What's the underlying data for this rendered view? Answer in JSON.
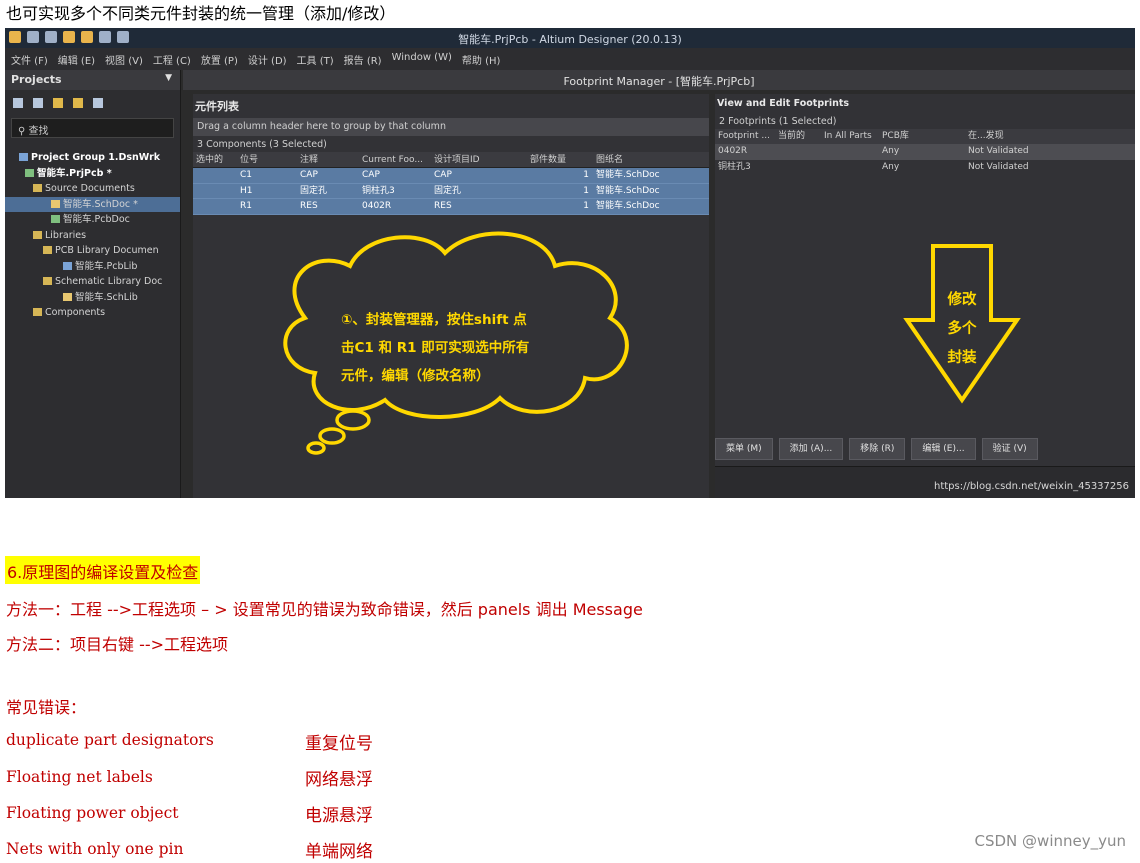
{
  "intro_text": "也可实现多个不同类元件封装的统一管理（添加/修改）",
  "app": {
    "title": "智能车.PrjPcb - Altium Designer (20.0.13)",
    "menu": [
      "文件 (F)",
      "编辑 (E)",
      "视图 (V)",
      "工程 (C)",
      "放置 (P)",
      "设计 (D)",
      "工具 (T)",
      "报告 (R)",
      "Window (W)",
      "帮助 (H)"
    ]
  },
  "projects_panel": {
    "header": "Projects",
    "search_placeholder": "查找",
    "tree": [
      "Project Group 1.DsnWrk",
      "智能车.PrjPcb *",
      "Source Documents",
      "智能车.SchDoc *",
      "智能车.PcbDoc",
      "Libraries",
      "PCB Library Documen",
      "智能车.PcbLib",
      "Schematic Library Doc",
      "智能车.SchLib",
      "Components"
    ]
  },
  "footprint_manager": {
    "title": "Footprint Manager - [智能车.PrjPcb]",
    "component_list": {
      "title": "元件列表",
      "group_hint": "Drag a column header here to group by that column",
      "count": "3 Components (3 Selected)",
      "columns": [
        "选中的",
        "位号",
        "注释",
        "Current Foo...",
        "设计项目ID",
        "部件数量",
        "图纸名"
      ],
      "rows": [
        [
          "",
          "C1",
          "CAP",
          "CAP",
          "CAP",
          "1",
          "智能车.SchDoc"
        ],
        [
          "",
          "H1",
          "固定孔",
          "铜柱孔3",
          "固定孔",
          "1",
          "智能车.SchDoc"
        ],
        [
          "",
          "R1",
          "RES",
          "0402R",
          "RES",
          "1",
          "智能车.SchDoc"
        ]
      ]
    },
    "footprints": {
      "title": "View and Edit Footprints",
      "count": "2 Footprints (1 Selected)",
      "columns": [
        "Footprint ...",
        "当前的",
        "In All Parts",
        "PCB库",
        "在...发现"
      ],
      "rows": [
        [
          "0402R",
          "",
          "",
          "Any",
          "Not Validated"
        ],
        [
          "铜柱孔3",
          "",
          "",
          "Any",
          "Not Validated"
        ]
      ]
    },
    "buttons": [
      "菜单 (M)",
      "添加 (A)...",
      "移除 (R)",
      "编辑 (E)...",
      "验证 (V)"
    ],
    "watermark_url": "https://blog.csdn.net/weixin_45337256"
  },
  "annotations": {
    "cloud_lines": [
      "①、封装管理器，按住shift 点",
      "击C1 和 R1 即可实现选中所有",
      "元件，编辑（修改名称）"
    ],
    "arrow_lines": [
      "修改",
      "多个",
      "封装"
    ],
    "yellow": "#ffd800"
  },
  "section6": {
    "heading": "6.原理图的编译设置及检查",
    "method1": "方法一：工程 -->工程选项 – > 设置常见的错误为致命错误，然后 panels 调出 Message",
    "method2": "方法二：项目右键 -->工程选项",
    "errors_heading": "常见错误：",
    "errors": [
      {
        "en": "duplicate part designators",
        "zh": "重复位号"
      },
      {
        "en": "Floating net labels",
        "zh": "网络悬浮"
      },
      {
        "en": "Floating power object",
        "zh": "电源悬浮"
      },
      {
        "en": "Nets with only one pin",
        "zh": "单端网络"
      }
    ]
  },
  "footer_watermark": "CSDN @winney_yun",
  "colors": {
    "text_red": "#c00000",
    "highlight": "#ffff00",
    "selection_blue": "#5a7ba3"
  }
}
